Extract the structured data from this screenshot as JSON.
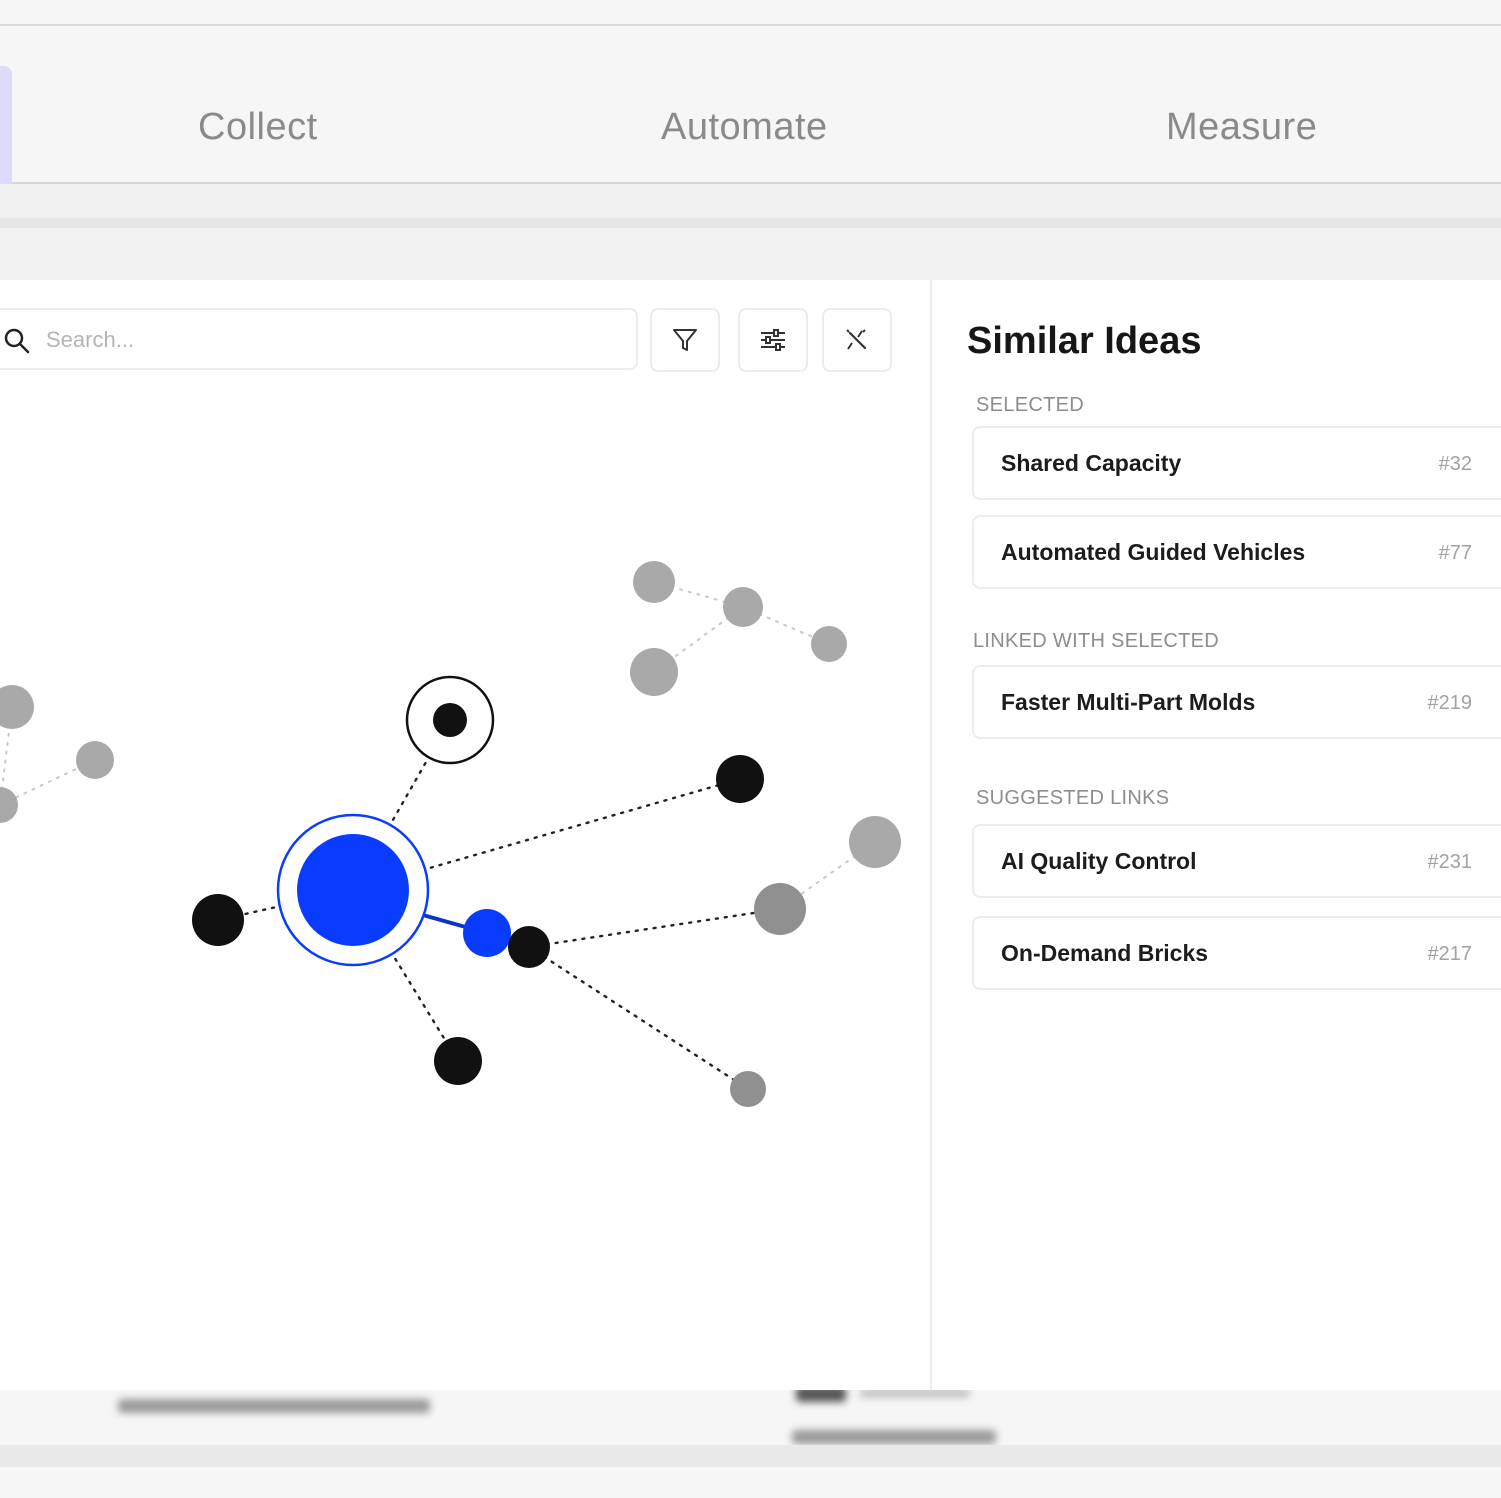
{
  "tabs": [
    {
      "label": "Collect"
    },
    {
      "label": "Automate"
    },
    {
      "label": "Measure"
    }
  ],
  "toolbar": {
    "search_placeholder": "Search...",
    "icons": [
      "search-icon",
      "filter-icon",
      "sliders-icon",
      "unlink-icon"
    ]
  },
  "similar": {
    "title": "Similar Ideas",
    "sections": [
      {
        "label": "SELECTED",
        "items": [
          {
            "name": "Shared Capacity",
            "id": "#32"
          },
          {
            "name": "Automated Guided Vehicles",
            "id": "#77"
          }
        ]
      },
      {
        "label": "LINKED WITH SELECTED",
        "items": [
          {
            "name": "Faster Multi-Part Molds",
            "id": "#219"
          }
        ]
      },
      {
        "label": "SUGGESTED LINKS",
        "items": [
          {
            "name": "AI Quality Control",
            "id": "#231"
          },
          {
            "name": "On-Demand Bricks",
            "id": "#217"
          }
        ]
      }
    ]
  },
  "colors": {
    "accent": "#0a3cff",
    "node_dark": "#111111",
    "node_gray": "#a9a9a9",
    "node_gray_dark": "#909090"
  }
}
